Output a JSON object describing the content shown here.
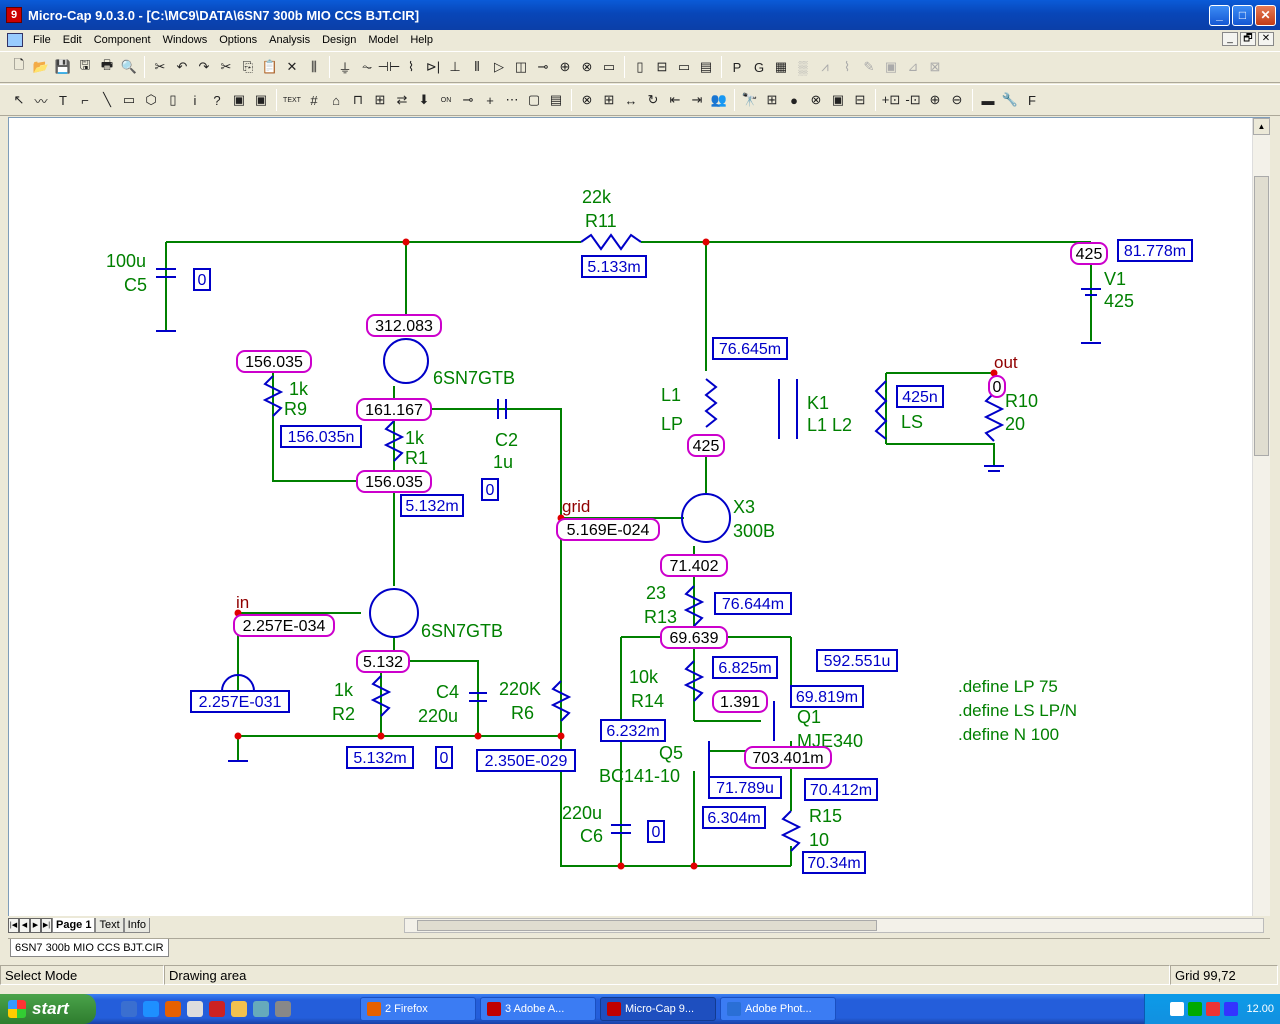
{
  "window": {
    "title": "Micro-Cap 9.0.3.0 - [C:\\MC9\\DATA\\6SN7  300b MIO CCS BJT.CIR]",
    "icon": "microcap-icon",
    "minimize": "_",
    "maximize": "□",
    "close": "✕"
  },
  "menu": [
    "File",
    "Edit",
    "Component",
    "Windows",
    "Options",
    "Analysis",
    "Design",
    "Model",
    "Help"
  ],
  "mdi_controls": [
    "_",
    "🗗",
    "✕"
  ],
  "toolbar1": [
    "🗋",
    "📂",
    "💾",
    "🖫",
    "🖶",
    "🔍",
    "✂",
    "↶",
    "↷",
    "✂",
    "⎘",
    "📋",
    "✕",
    "⫼",
    "⏚",
    "⏦",
    "⊣⊢",
    "⌇",
    "⊳|",
    "⊥",
    "⫴",
    "▷",
    "◫",
    "⊸",
    "⊕",
    "⊗",
    "▭",
    "▯",
    "⊟",
    "▭",
    "▤",
    "P",
    "G",
    "▦",
    "▒",
    "⩘",
    "⌇",
    "✎",
    "▣",
    "⊿",
    "⊠"
  ],
  "toolbar1_dim_from": 34,
  "toolbar2": [
    "↖",
    "〰",
    "T",
    "⌐",
    "╲",
    "▭",
    "⬡",
    "▯",
    "i",
    "?",
    "▣",
    "▣",
    "TEXT",
    "#",
    "⌂",
    "⊓",
    "⊞",
    "⇄",
    "⬇",
    "ON",
    "⊸",
    "+",
    "⋯",
    "▢",
    "▤",
    "⊗",
    "⊞",
    "↔",
    "↻",
    "⇤",
    "⇥",
    "👥",
    "🔭",
    "⊞",
    "●",
    "⊗",
    "▣",
    "⊟",
    "+⊡",
    "-⊡",
    "⊕",
    "⊖",
    "▬",
    "🔧",
    "F"
  ],
  "page_tabs": {
    "active": "Page 1",
    "others": [
      "Text",
      "Info"
    ]
  },
  "doc_tab": "6SN7  300b MIO CCS BJT.CIR",
  "status": {
    "mode": "Select Mode",
    "area": "Drawing area",
    "grid": "Grid 99,72"
  },
  "taskbar": {
    "start": "start",
    "tasks": [
      {
        "label": "2 Firefox",
        "color": "#e66000",
        "active": false
      },
      {
        "label": "3 Adobe A...",
        "color": "#c00000",
        "active": false
      },
      {
        "label": "Micro-Cap 9...",
        "color": "#c00000",
        "active": true
      },
      {
        "label": "Adobe Phot...",
        "color": "#2a6fd6",
        "active": false
      }
    ],
    "clock": "12.00"
  },
  "schematic": {
    "green_labels": [
      {
        "t": "22k"
      },
      {
        "t": "R11"
      },
      {
        "t": "100u"
      },
      {
        "t": "C5"
      },
      {
        "t": "V1"
      },
      {
        "t": "425"
      },
      {
        "t": "6SN7GTB"
      },
      {
        "t": "1k"
      },
      {
        "t": "R9"
      },
      {
        "t": "1k"
      },
      {
        "t": "R1"
      },
      {
        "t": "C2"
      },
      {
        "t": "1u"
      },
      {
        "t": "L1"
      },
      {
        "t": "LP"
      },
      {
        "t": "K1"
      },
      {
        "t": "L1 L2"
      },
      {
        "t": "LS"
      },
      {
        "t": "R10"
      },
      {
        "t": "20"
      },
      {
        "t": "X3"
      },
      {
        "t": "300B"
      },
      {
        "t": "23"
      },
      {
        "t": "R13"
      },
      {
        "t": "6SN7GTB"
      },
      {
        "t": "1k"
      },
      {
        "t": "R2"
      },
      {
        "t": "C4"
      },
      {
        "t": "220u"
      },
      {
        "t": "220K"
      },
      {
        "t": "R6"
      },
      {
        "t": "10k"
      },
      {
        "t": "R14"
      },
      {
        "t": "Q1"
      },
      {
        "t": "MJE340"
      },
      {
        "t": "Q5"
      },
      {
        "t": "BC141-10"
      },
      {
        "t": "220u"
      },
      {
        "t": "C6"
      },
      {
        "t": "R15"
      },
      {
        "t": "10"
      },
      {
        "t": ".define LP 75"
      },
      {
        "t": ".define LS LP/N"
      },
      {
        "t": ".define N 100"
      }
    ],
    "dark_labels": [
      {
        "t": "out"
      },
      {
        "t": "grid"
      },
      {
        "t": "in"
      }
    ],
    "voltage_boxes": [
      {
        "t": "312.083"
      },
      {
        "t": "156.035"
      },
      {
        "t": "161.167"
      },
      {
        "t": "156.035"
      },
      {
        "t": "425"
      },
      {
        "t": "425"
      },
      {
        "t": "0"
      },
      {
        "t": "5.169E-024"
      },
      {
        "t": "71.402"
      },
      {
        "t": "2.257E-034"
      },
      {
        "t": "5.132"
      },
      {
        "t": "69.639"
      },
      {
        "t": "1.391"
      },
      {
        "t": "703.401m"
      }
    ],
    "current_boxes": [
      {
        "t": "5.133m"
      },
      {
        "t": "81.778m"
      },
      {
        "t": "0"
      },
      {
        "t": "76.645m"
      },
      {
        "t": "156.035n"
      },
      {
        "t": "425n"
      },
      {
        "t": "0"
      },
      {
        "t": "5.132m"
      },
      {
        "t": "76.644m"
      },
      {
        "t": "592.551u"
      },
      {
        "t": "6.825m"
      },
      {
        "t": "69.819m"
      },
      {
        "t": "2.257E-031"
      },
      {
        "t": "6.232m"
      },
      {
        "t": "5.132m"
      },
      {
        "t": "0"
      },
      {
        "t": "2.350E-029"
      },
      {
        "t": "71.789u"
      },
      {
        "t": "70.412m"
      },
      {
        "t": "6.304m"
      },
      {
        "t": "0"
      },
      {
        "t": "70.34m"
      }
    ]
  }
}
